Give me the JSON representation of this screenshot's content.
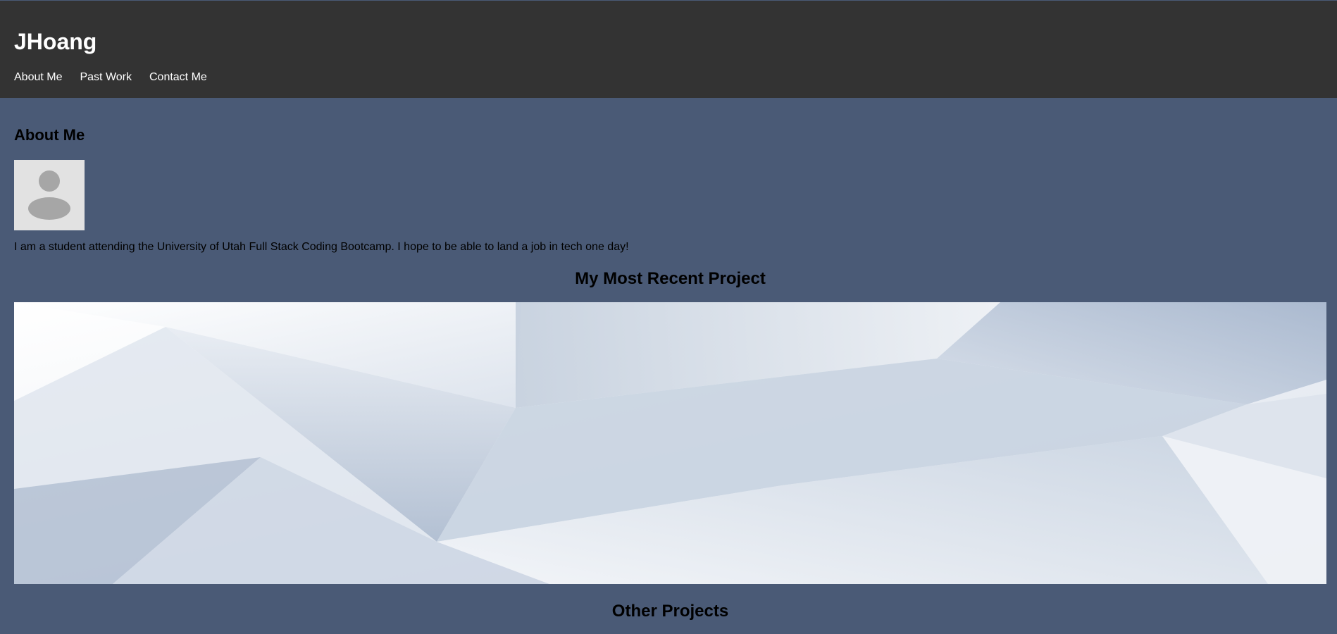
{
  "header": {
    "site_title": "JHoang",
    "nav": [
      {
        "label": "About Me"
      },
      {
        "label": "Past Work"
      },
      {
        "label": "Contact Me"
      }
    ]
  },
  "about": {
    "heading": "About Me",
    "avatar_icon": "user-avatar-placeholder-icon",
    "bio": "I am a student attending the University of Utah Full Stack Coding Bootcamp. I hope to be able to land a job in tech one day!"
  },
  "recent_project": {
    "heading": "My Most Recent Project"
  },
  "other_projects": {
    "heading": "Other Projects"
  },
  "colors": {
    "page_background": "#4a5a76",
    "header_background": "#333333",
    "header_text": "#ffffff"
  }
}
